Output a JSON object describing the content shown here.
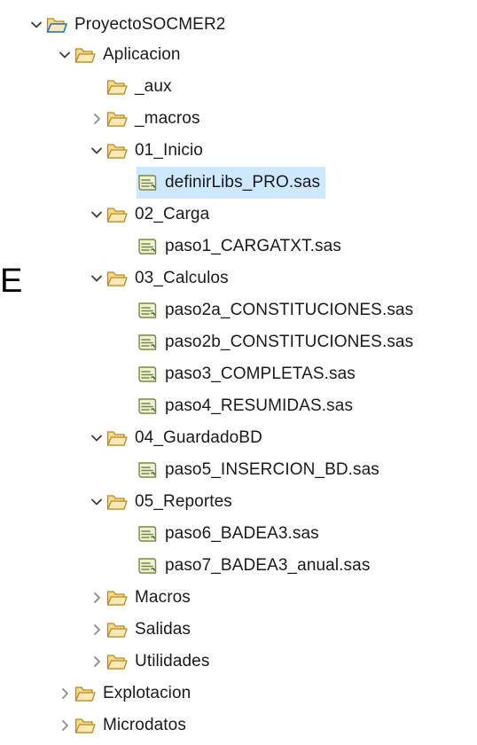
{
  "stray_text": "E",
  "tree": {
    "items": [
      {
        "label": "ProyectoSOCMER2",
        "type": "project",
        "expanded": true
      },
      {
        "label": "Aplicacion",
        "type": "folder",
        "expanded": true
      },
      {
        "label": "_aux",
        "type": "folder",
        "expanded": null
      },
      {
        "label": "_macros",
        "type": "folder",
        "expanded": false
      },
      {
        "label": "01_Inicio",
        "type": "folder",
        "expanded": true
      },
      {
        "label": "definirLibs_PRO.sas",
        "type": "file",
        "selected": true
      },
      {
        "label": "02_Carga",
        "type": "folder",
        "expanded": true
      },
      {
        "label": "paso1_CARGATXT.sas",
        "type": "file"
      },
      {
        "label": "03_Calculos",
        "type": "folder",
        "expanded": true
      },
      {
        "label": "paso2a_CONSTITUCIONES.sas",
        "type": "file"
      },
      {
        "label": "paso2b_CONSTITUCIONES.sas",
        "type": "file"
      },
      {
        "label": "paso3_COMPLETAS.sas",
        "type": "file"
      },
      {
        "label": "paso4_RESUMIDAS.sas",
        "type": "file"
      },
      {
        "label": "04_GuardadoBD",
        "type": "folder",
        "expanded": true
      },
      {
        "label": "paso5_INSERCION_BD.sas",
        "type": "file"
      },
      {
        "label": "05_Reportes",
        "type": "folder",
        "expanded": true
      },
      {
        "label": "paso6_BADEA3.sas",
        "type": "file"
      },
      {
        "label": "paso7_BADEA3_anual.sas",
        "type": "file"
      },
      {
        "label": "Macros",
        "type": "folder",
        "expanded": false
      },
      {
        "label": "Salidas",
        "type": "folder",
        "expanded": false
      },
      {
        "label": "Utilidades",
        "type": "folder",
        "expanded": false
      },
      {
        "label": "Explotacion",
        "type": "folder",
        "expanded": false
      },
      {
        "label": "Microdatos",
        "type": "folder",
        "expanded": false
      }
    ]
  },
  "colors": {
    "selection": "#cde8ff",
    "folder_fill": "#f3d98a",
    "folder_stroke": "#b98a1d",
    "project_accent": "#2a73c9",
    "file_icon": "#7a8a3a"
  }
}
